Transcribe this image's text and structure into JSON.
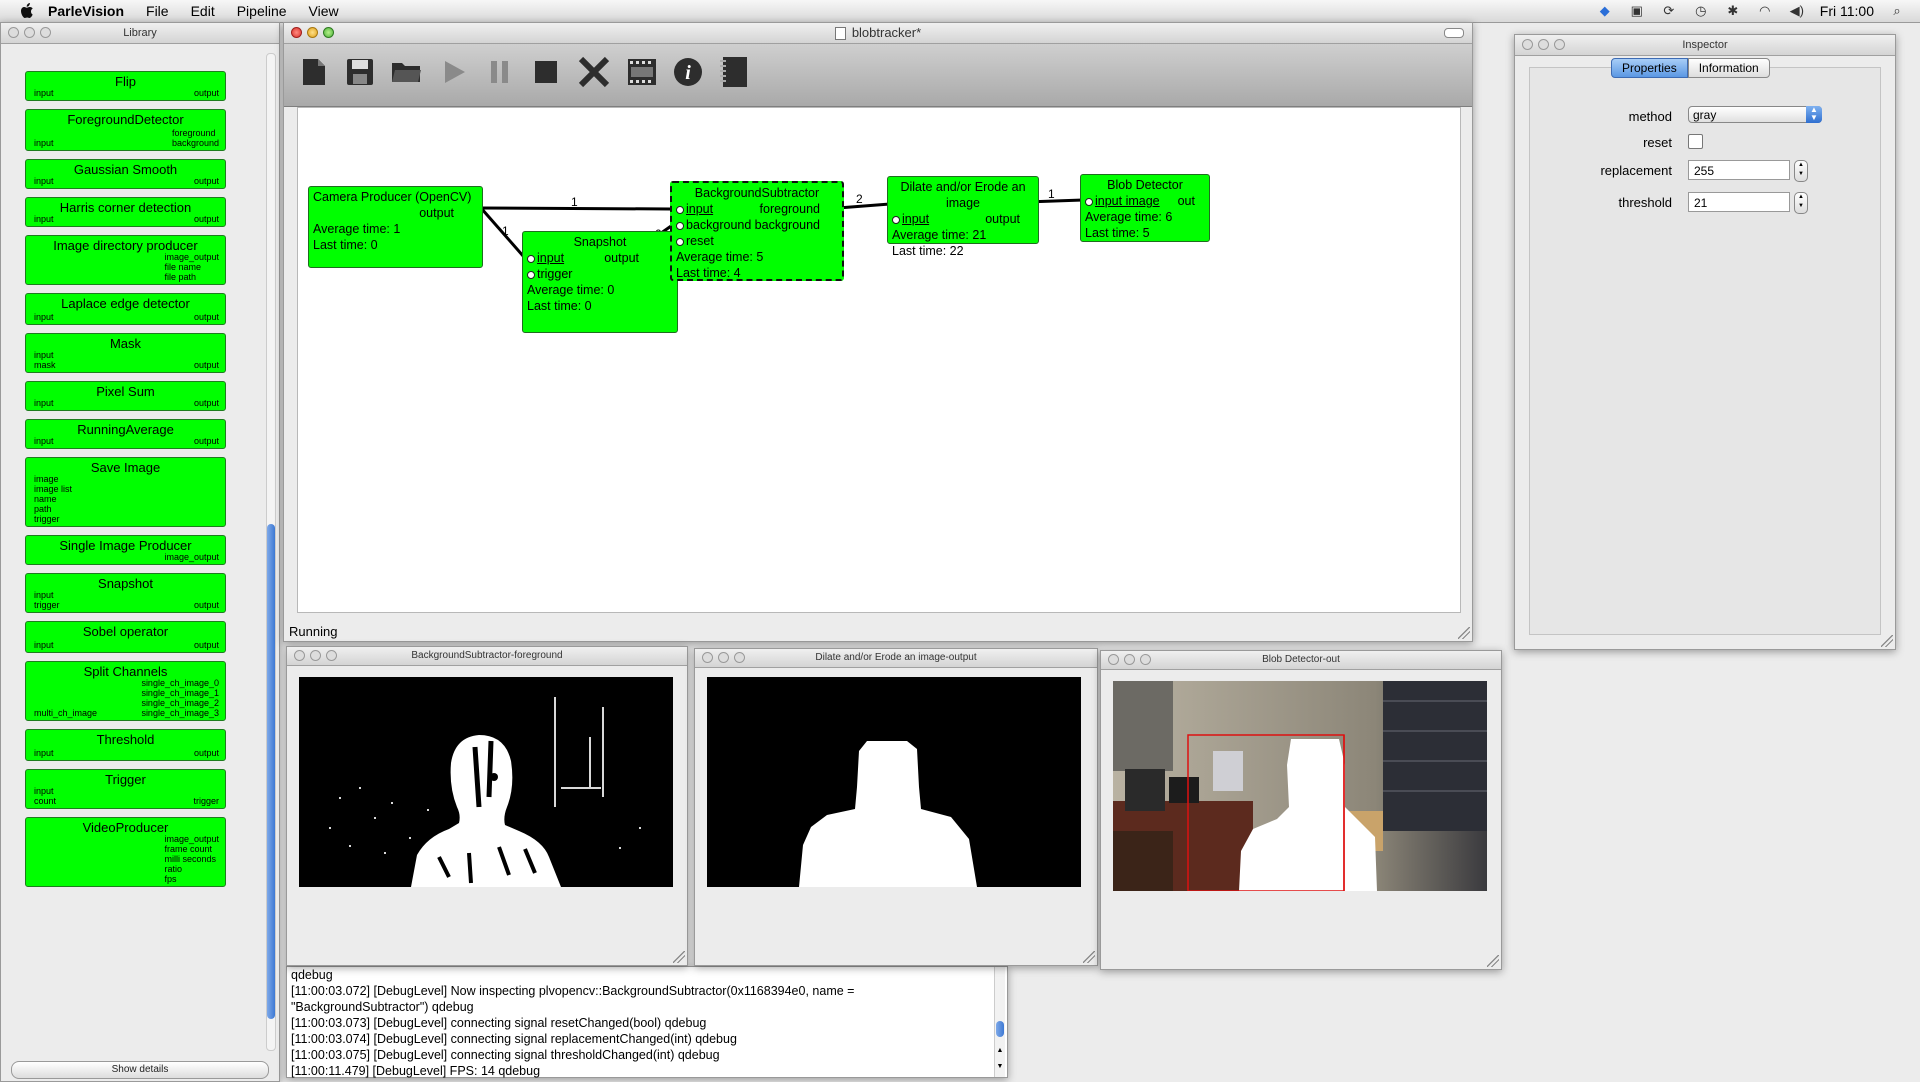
{
  "menubar": {
    "app_name": "ParleVision",
    "items": [
      "File",
      "Edit",
      "Pipeline",
      "View"
    ],
    "clock": "Fri 11:00",
    "status_icons": [
      "dropbox-icon",
      "display-icon",
      "sync-icon",
      "time-machine-icon",
      "bluetooth-icon",
      "wifi-icon",
      "volume-icon",
      "spotlight-icon"
    ]
  },
  "library": {
    "title": "Library",
    "show_details": "Show details",
    "items": [
      {
        "name": "Flip",
        "ins": [
          "input"
        ],
        "outs": [
          "output"
        ]
      },
      {
        "name": "ForegroundDetector",
        "ins": [
          "input"
        ],
        "outs": [
          "foreground",
          "background"
        ]
      },
      {
        "name": "Gaussian Smooth",
        "ins": [
          "input"
        ],
        "outs": [
          "output"
        ]
      },
      {
        "name": "Harris corner detection",
        "ins": [
          "input"
        ],
        "outs": [
          "output"
        ]
      },
      {
        "name": "Image directory producer",
        "ins": [],
        "outs": [
          "image_output",
          "file name",
          "file path"
        ]
      },
      {
        "name": "Laplace edge detector",
        "ins": [
          "input"
        ],
        "outs": [
          "output"
        ]
      },
      {
        "name": "Mask",
        "ins": [
          "input",
          "mask"
        ],
        "outs": [
          "output"
        ]
      },
      {
        "name": "Pixel Sum",
        "ins": [
          "input"
        ],
        "outs": [
          "output"
        ]
      },
      {
        "name": "RunningAverage",
        "ins": [
          "input"
        ],
        "outs": [
          "output"
        ]
      },
      {
        "name": "Save Image",
        "ins": [
          "image",
          "image list",
          "name",
          "path",
          "trigger"
        ],
        "outs": []
      },
      {
        "name": "Single Image Producer",
        "ins": [],
        "outs": [
          "image_output"
        ]
      },
      {
        "name": "Snapshot",
        "ins": [
          "input",
          "trigger"
        ],
        "outs": [
          "output"
        ]
      },
      {
        "name": "Sobel operator",
        "ins": [
          "input"
        ],
        "outs": [
          "output"
        ]
      },
      {
        "name": "Split Channels",
        "ins": [
          "multi_ch_image"
        ],
        "outs": [
          "single_ch_image_0",
          "single_ch_image_1",
          "single_ch_image_2",
          "single_ch_image_3"
        ]
      },
      {
        "name": "Threshold",
        "ins": [
          "input"
        ],
        "outs": [
          "output"
        ]
      },
      {
        "name": "Trigger",
        "ins": [
          "input",
          "count"
        ],
        "outs": [
          "trigger"
        ]
      },
      {
        "name": "VideoProducer",
        "ins": [],
        "outs": [
          "image_output",
          "frame count",
          "milli seconds",
          "ratio",
          "fps"
        ]
      }
    ]
  },
  "main_window": {
    "title": "blobtracker*",
    "status": "Running",
    "toolbar": [
      "new-file-icon",
      "save-icon",
      "open-folder-icon",
      "play-icon",
      "pause-icon",
      "stop-icon",
      "clear-icon",
      "film-icon",
      "info-icon",
      "notebook-icon"
    ],
    "nodes": {
      "camera": {
        "title": "Camera Producer (OpenCV)",
        "out": "output",
        "avg": "Average time: 1",
        "last": "Last time: 0"
      },
      "snapshot": {
        "title": "Snapshot",
        "in1": "input",
        "in2": "trigger",
        "out": "output",
        "avg": "Average time: 0",
        "last": "Last time: 0"
      },
      "bgsub": {
        "title": "BackgroundSubtractor",
        "in1": "input",
        "in2": "background",
        "in3": "reset",
        "out1": "foreground",
        "out2": "background",
        "avg": "Average time: 5",
        "last": "Last time: 4"
      },
      "dilate": {
        "title": "Dilate and/or Erode an image",
        "in1": "input",
        "out": "output",
        "avg": "Average time: 21",
        "last": "Last time: 22"
      },
      "blob": {
        "title": "Blob Detector",
        "in1": "input image",
        "out": "out",
        "avg": "Average time: 6",
        "last": "Last time: 5"
      }
    },
    "wire_labels": [
      "1",
      "1",
      "0",
      "2",
      "1"
    ]
  },
  "inspector": {
    "title": "Inspector",
    "tabs": [
      "Properties",
      "Information"
    ],
    "method_label": "method",
    "method_value": "gray",
    "reset_label": "reset",
    "replacement_label": "replacement",
    "replacement_value": "255",
    "threshold_label": "threshold",
    "threshold_value": "21"
  },
  "viewers": {
    "v1": "BackgroundSubtractor-foreground",
    "v2": "Dilate and/or Erode an image-output",
    "v3": "Blob Detector-out"
  },
  "console": {
    "lines": [
      "qdebug",
      "[11:00:03.072] [DebugLevel] Now inspecting  plvopencv::BackgroundSubtractor(0x1168394e0, name =",
      "\"BackgroundSubtractor\")  qdebug",
      "[11:00:03.073] [DebugLevel] connecting signal  resetChanged(bool)  qdebug",
      "[11:00:03.074] [DebugLevel] connecting signal  replacementChanged(int)  qdebug",
      "[11:00:03.075] [DebugLevel] connecting signal  thresholdChanged(int)  qdebug",
      "[11:00:11.479] [DebugLevel] FPS:  14  qdebug"
    ]
  }
}
